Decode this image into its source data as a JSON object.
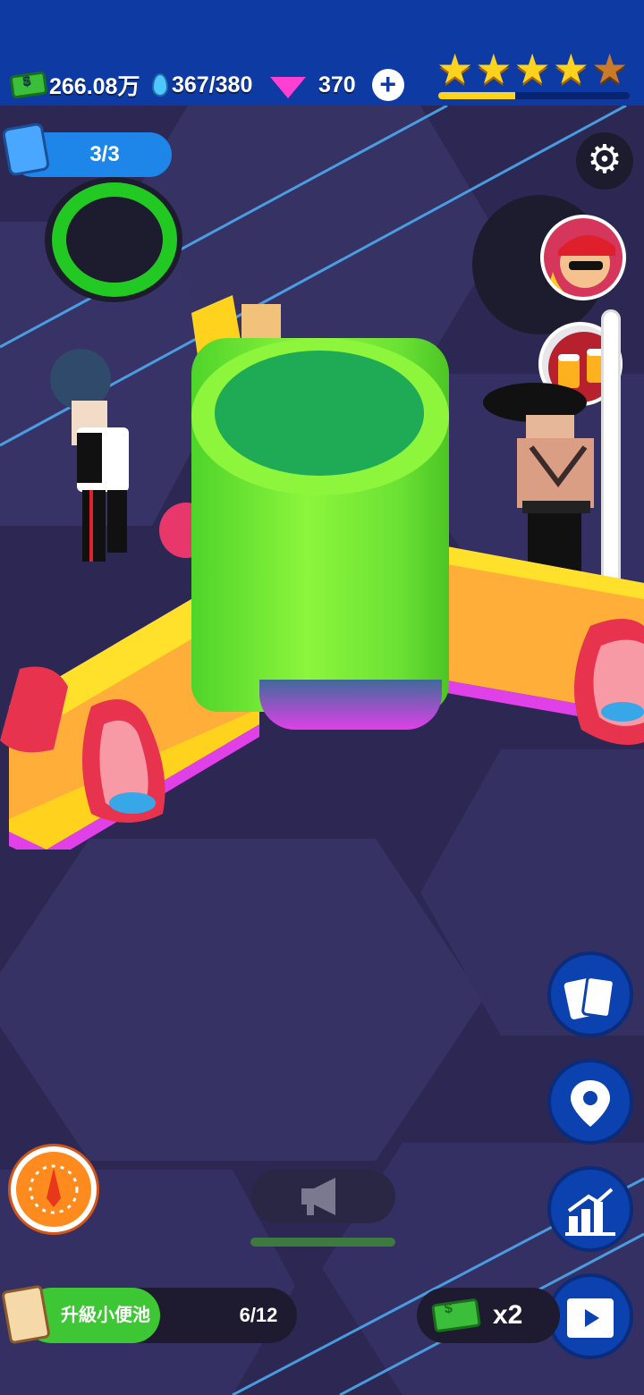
{
  "hud": {
    "cash": "266.08万",
    "water": "367/380",
    "gems": "370",
    "add_label": "+",
    "stars_filled": 4,
    "stars_total": 5,
    "star_progress": 0.4
  },
  "customers": {
    "count": "3/3"
  },
  "icons": {
    "settings": "⚙",
    "cards": "▦",
    "location": "⌖",
    "stats": "▲",
    "wheel": "◉",
    "megaphone": "📢",
    "video": "▶"
  },
  "upgrade": {
    "label": "升級小便池",
    "progress": "6/12",
    "fill": 0.5
  },
  "boost": {
    "label": "x2"
  },
  "colors": {
    "topbar": "#0d3aa3",
    "floor": "#2c2853",
    "tank": "#8cf53c",
    "accent_blue": "#0b42b0"
  }
}
